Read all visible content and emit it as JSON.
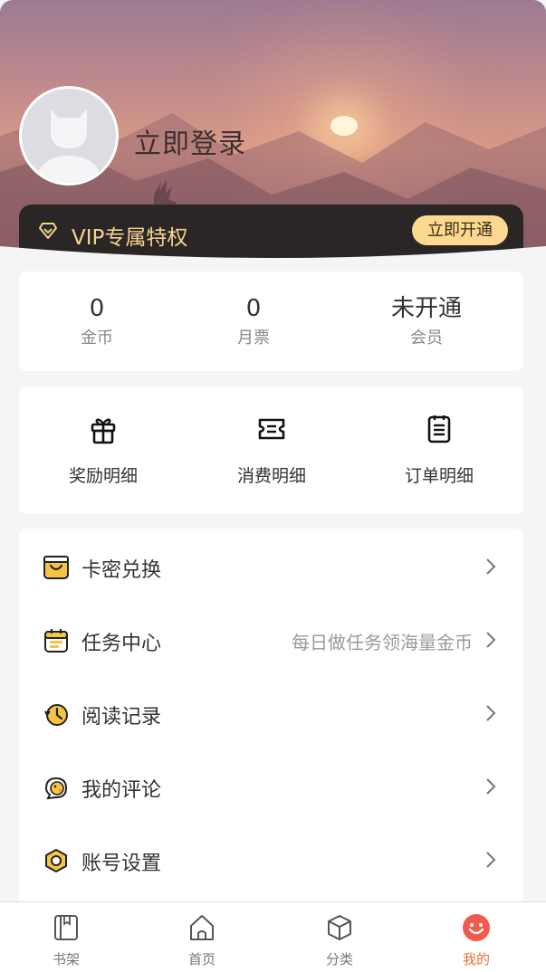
{
  "header": {
    "login_text": "立即登录",
    "vip_title": "VIP专属特权",
    "vip_button": "立即开通"
  },
  "stats": [
    {
      "value": "0",
      "label": "金币"
    },
    {
      "value": "0",
      "label": "月票"
    },
    {
      "value": "未开通",
      "label": "会员"
    }
  ],
  "details": [
    {
      "label": "奖励明细",
      "icon": "gift-icon"
    },
    {
      "label": "消费明细",
      "icon": "ticket-icon"
    },
    {
      "label": "订单明细",
      "icon": "order-list-icon"
    }
  ],
  "menu": [
    {
      "label": "卡密兑换",
      "hint": "",
      "icon": "card-redeem-icon"
    },
    {
      "label": "任务中心",
      "hint": "每日做任务领海量金币",
      "icon": "calendar-task-icon"
    },
    {
      "label": "阅读记录",
      "hint": "",
      "icon": "history-clock-icon"
    },
    {
      "label": "我的评论",
      "hint": "",
      "icon": "comment-chick-icon"
    },
    {
      "label": "账号设置",
      "hint": "",
      "icon": "settings-icon"
    }
  ],
  "tabbar": [
    {
      "label": "书架",
      "icon": "bookshelf-icon",
      "active": false
    },
    {
      "label": "首页",
      "icon": "home-icon",
      "active": false
    },
    {
      "label": "分类",
      "icon": "category-box-icon",
      "active": false
    },
    {
      "label": "我的",
      "icon": "smile-face-icon",
      "active": true
    }
  ],
  "colors": {
    "vip_gold": "#f4d391",
    "vip_button_bg": "#fbd98f",
    "vip_bar_bg": "#2b2626",
    "accent_orange": "#e8743a",
    "active_tab_icon": "#f25b4c",
    "menu_icon_yellow": "#f6c445"
  }
}
